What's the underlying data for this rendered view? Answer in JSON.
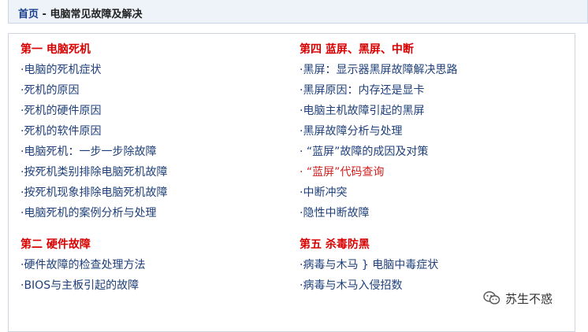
{
  "breadcrumb": {
    "home": "首页",
    "separator": " - ",
    "current": "电脑常见故障及解决"
  },
  "left_column": [
    {
      "title": "第一 电脑死机",
      "items": [
        {
          "text": "电脑的死机症状",
          "red": false
        },
        {
          "text": "死机的原因",
          "red": false
        },
        {
          "text": "死机的硬件原因",
          "red": false
        },
        {
          "text": "死机的软件原因",
          "red": false
        },
        {
          "text": "电脑死机：一步一步除故障",
          "red": false
        },
        {
          "text": "按死机类别排除电脑死机故障",
          "red": false
        },
        {
          "text": "按死机现象排除电脑死机故障",
          "red": false
        },
        {
          "text": "电脑死机的案例分析与处理",
          "red": false
        }
      ]
    },
    {
      "title": "第二 硬件故障",
      "items": [
        {
          "text": "硬件故障的检查处理方法",
          "red": false
        },
        {
          "text": "BIOS与主板引起的故障",
          "red": false
        }
      ]
    }
  ],
  "right_column": [
    {
      "title": "第四 蓝屏、黑屏、中断",
      "items": [
        {
          "text": "黑屏：显示器黑屏故障解决思路",
          "red": false
        },
        {
          "text": "黑屏原因：内存还是显卡",
          "red": false
        },
        {
          "text": "电脑主机故障引起的黑屏",
          "red": false
        },
        {
          "text": "黑屏故障分析与处理",
          "red": false
        },
        {
          "text": " “蓝屏”故障的成因及对策",
          "red": false
        },
        {
          "text": " “蓝屏”代码查询",
          "red": true
        },
        {
          "text": "中断冲突",
          "red": false
        },
        {
          "text": "隐性中断故障",
          "red": false
        }
      ]
    },
    {
      "title": "第五 杀毒防黑",
      "items": [
        {
          "text": "病毒与木马 } 电脑中毒症状",
          "red": false
        },
        {
          "text": "病毒与木马入侵招数",
          "red": false
        }
      ]
    }
  ],
  "bullet": "·",
  "watermark": {
    "text": "苏生不惑",
    "icon": "wechat-icon"
  }
}
